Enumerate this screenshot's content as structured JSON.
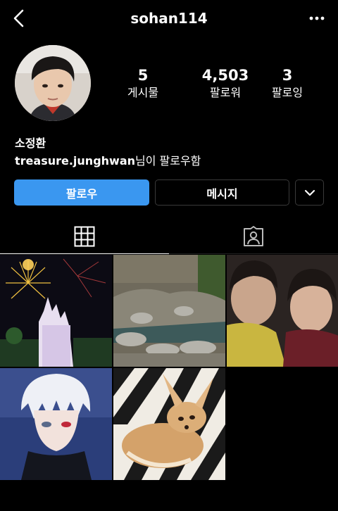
{
  "header": {
    "username": "sohan114",
    "back_icon": "chevron-left-icon",
    "more_icon": "more-horizontal-icon"
  },
  "profile": {
    "display_name": "소정환",
    "followed_by_user": "treasure.junghwan",
    "followed_by_suffix": "님이 팔로우함"
  },
  "stats": [
    {
      "value": "5",
      "label": "게시물"
    },
    {
      "value": "4,503",
      "label": "팔로워"
    },
    {
      "value": "3",
      "label": "팔로잉"
    }
  ],
  "actions": {
    "follow_label": "팔로우",
    "message_label": "메시지",
    "suggest_icon": "chevron-down-icon"
  },
  "tabs": [
    {
      "icon": "grid-icon",
      "selected": true
    },
    {
      "icon": "tagged-person-icon",
      "selected": false
    }
  ],
  "colors": {
    "background": "#000000",
    "follow_button": "#3a97f0",
    "button_border": "#3a3a3a"
  },
  "posts": [
    {
      "subject": "fireworks over castle"
    },
    {
      "subject": "rock waterfall garden"
    },
    {
      "subject": "two boys selfie"
    },
    {
      "subject": "white-haired anime character"
    },
    {
      "subject": "fennec fox on zebra blanket"
    }
  ]
}
